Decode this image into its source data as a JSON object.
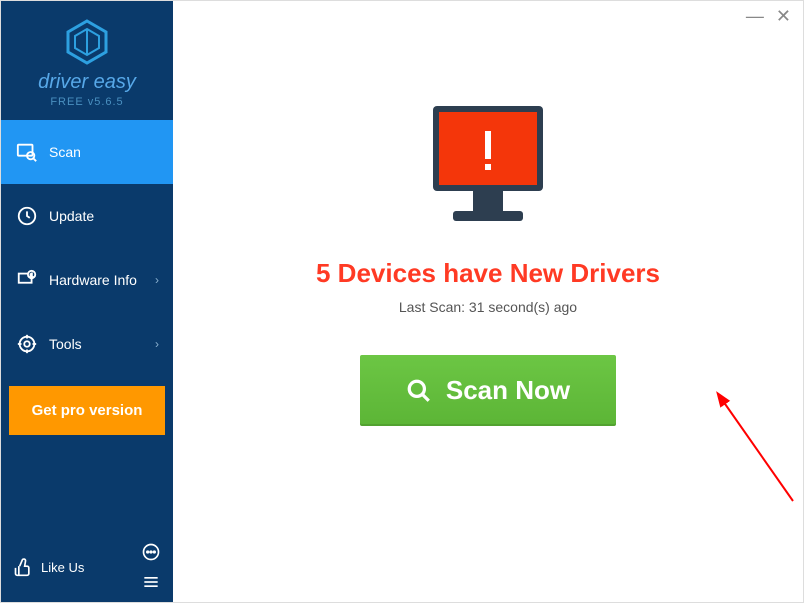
{
  "brand": "driver easy",
  "version": "FREE v5.6.5",
  "nav": {
    "scan": "Scan",
    "update": "Update",
    "hardware": "Hardware Info",
    "tools": "Tools"
  },
  "pro_button": "Get pro version",
  "like_us": "Like Us",
  "main": {
    "headline": "5 Devices have New Drivers",
    "last_scan": "Last Scan: 31 second(s) ago",
    "scan_button": "Scan Now"
  },
  "window": {
    "minimize": "—",
    "close": "✕"
  }
}
